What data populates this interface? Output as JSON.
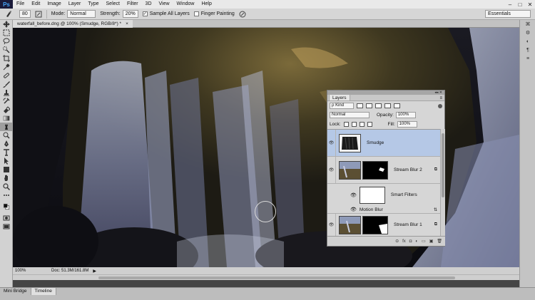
{
  "app": {
    "logo": "Ps"
  },
  "menu": [
    "File",
    "Edit",
    "Image",
    "Layer",
    "Type",
    "Select",
    "Filter",
    "3D",
    "View",
    "Window",
    "Help"
  ],
  "window_controls": [
    "–",
    "□",
    "✕"
  ],
  "options": {
    "brush_size": "80",
    "mode_label": "Mode:",
    "mode_value": "Normal",
    "strength_label": "Strength:",
    "strength_value": "20%",
    "sample_all_layers": "Sample All Layers",
    "finger_painting": "Finger Painting",
    "workspace": "Essentials"
  },
  "document": {
    "tab_title": "waterfall_before.dng @ 100% (Smudge, RGB/8*) *",
    "close": "×"
  },
  "status": {
    "zoom": "100%",
    "doc_info": "Doc: 51.3M/161.8M",
    "arrow": "▶"
  },
  "bottom_tabs": [
    "Mini Bridge",
    "Timeline"
  ],
  "layers_panel": {
    "title": "Layers",
    "filter_kind": "ρ Kind",
    "blend_mode": "Normal",
    "opacity_label": "Opacity:",
    "opacity_value": "100%",
    "lock_label": "Lock:",
    "fill_label": "Fill:",
    "fill_value": "100%",
    "layers": [
      {
        "name": "Smudge",
        "selected": true
      },
      {
        "name": "Stream Blur 2",
        "selected": false
      },
      {
        "name": "Smart Filters",
        "selected": false
      },
      {
        "name": "Motion Blur",
        "selected": false
      },
      {
        "name": "Stream Blur 1",
        "selected": false
      }
    ],
    "bottom_icons": [
      "⊝",
      "fx",
      "◘",
      "◐",
      "▭",
      "▣",
      "🗑"
    ]
  },
  "colors": {
    "selected_layer": "#b5c8e6",
    "ps_logo_bg": "#1b1b3a",
    "ps_logo_fg": "#46a3f5"
  }
}
